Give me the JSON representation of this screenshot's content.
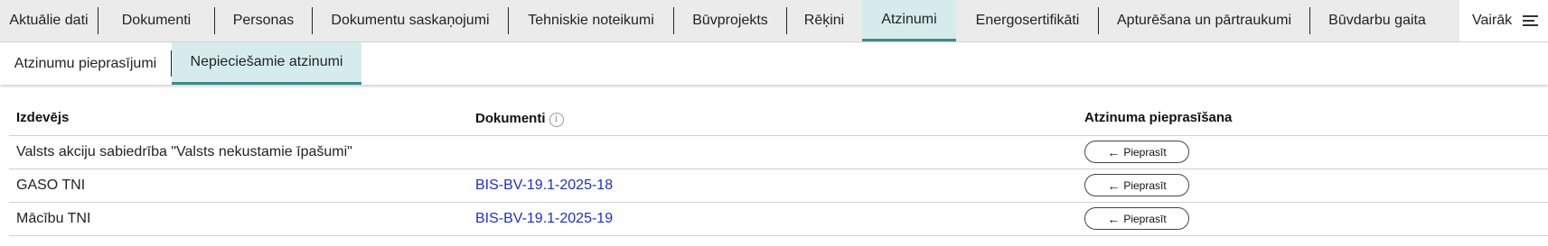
{
  "tabs": [
    {
      "label": "Aktuālie dati"
    },
    {
      "label": "Dokumenti"
    },
    {
      "label": "Personas"
    },
    {
      "label": "Dokumentu saskaņojumi"
    },
    {
      "label": "Tehniskie noteikumi"
    },
    {
      "label": "Būvprojekts"
    },
    {
      "label": "Rēķini"
    },
    {
      "label": "Atzinumi"
    },
    {
      "label": "Energosertifikāti"
    },
    {
      "label": "Apturēšana un pārtraukumi"
    },
    {
      "label": "Būvdarbu gaita"
    }
  ],
  "active_tab": "Atzinumi",
  "more": {
    "label": "Vairāk",
    "icon": "hamburger-menu-icon"
  },
  "subtabs": [
    {
      "label": "Atzinumu pieprasījumi"
    },
    {
      "label": "Nepieciešamie atzinumi"
    }
  ],
  "active_subtab": "Nepieciešamie atzinumi",
  "table": {
    "headers": {
      "issuer": "Izdevējs",
      "documents": "Dokumenti",
      "request": "Atzinuma pieprasīšana"
    },
    "info_icon": "i",
    "rows": [
      {
        "issuer": "Valsts akciju sabiedrība \"Valsts nekustamie īpašumi\"",
        "document": "",
        "action": "Pieprasīt"
      },
      {
        "issuer": "GASO TNI",
        "document": "BIS-BV-19.1-2025-18",
        "action": "Pieprasīt"
      },
      {
        "issuer": "Mācību TNI",
        "document": "BIS-BV-19.1-2025-19",
        "action": "Pieprasīt"
      }
    ]
  },
  "colors": {
    "accent": "#3d8b8b",
    "active_bg": "#d6ecec",
    "link": "#1a2fd6",
    "tabbar_bg": "#ebebeb"
  }
}
